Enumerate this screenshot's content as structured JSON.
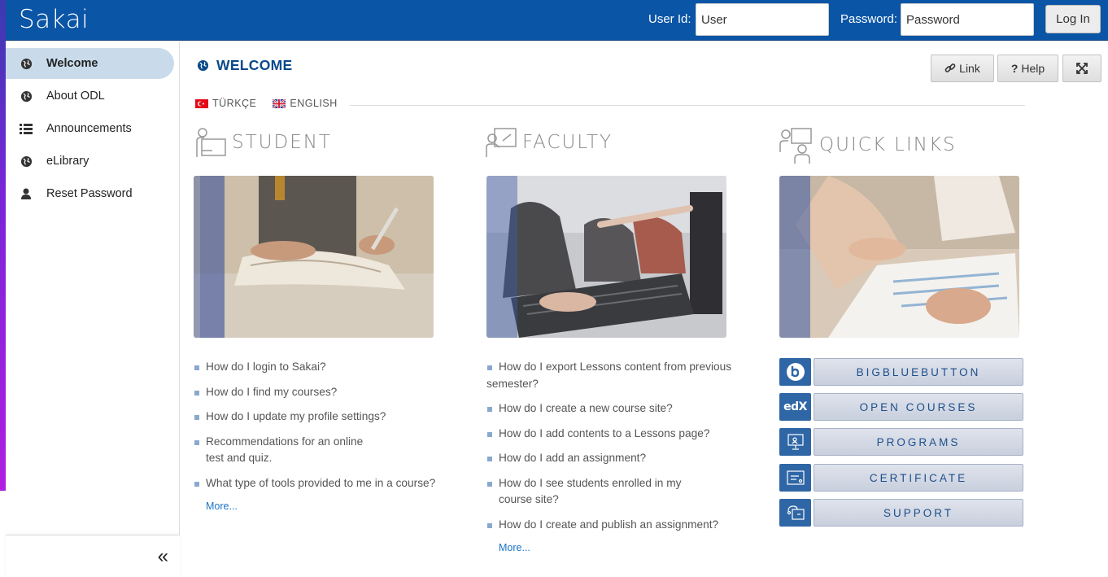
{
  "app": {
    "logo": "Sakai"
  },
  "login": {
    "user_label": "User Id:",
    "user_value": "User",
    "password_label": "Password:",
    "password_value": "Password",
    "login_button": "Log In"
  },
  "sidebar": {
    "items": [
      {
        "label": "Welcome",
        "icon": "globe-icon",
        "active": true
      },
      {
        "label": "About ODL",
        "icon": "globe-icon"
      },
      {
        "label": "Announcements",
        "icon": "list-icon"
      },
      {
        "label": "eLibrary",
        "icon": "globe-icon"
      },
      {
        "label": "Reset Password",
        "icon": "user-icon"
      }
    ],
    "collapse_glyph": "«"
  },
  "page": {
    "title": "WELCOME",
    "toolbar": {
      "link": "Link",
      "help": "Help",
      "fullscreen_icon": "expand-icon"
    }
  },
  "languages": [
    {
      "label": "TÜRKÇE",
      "flag": "turkey-flag"
    },
    {
      "label": "ENGLISH",
      "flag": "uk-flag"
    }
  ],
  "student": {
    "heading": "STUDENT",
    "faq": [
      "How do I login to Sakai?",
      "How do I find my courses?",
      "How do I update my profile settings?",
      "Recommendations for an online test and quiz.",
      "What type of tools provided to me in a course?"
    ],
    "more": "More..."
  },
  "faculty": {
    "heading": "FACULTY",
    "faq": [
      "How do I export Lessons content from previous semester?",
      "How do I create a new course site?",
      "How do I add contents to a Lessons page?",
      "How do I add an assignment?",
      "How do I see students enrolled in my course site?",
      "How do I create and publish an assignment?"
    ],
    "more": "More..."
  },
  "quick_links": {
    "heading": "QUICK LINKS",
    "items": [
      {
        "label": "BIGBLUEBUTTON",
        "icon": "bigbluebutton-icon"
      },
      {
        "label": "OPEN COURSES",
        "icon": "edx-icon",
        "icon_text": "edX"
      },
      {
        "label": "PROGRAMS",
        "icon": "presentation-icon"
      },
      {
        "label": "CERTIFICATE",
        "icon": "certificate-icon"
      },
      {
        "label": "SUPPORT",
        "icon": "support-icon"
      }
    ]
  },
  "colors": {
    "header": "#0a55a6",
    "title": "#0a4a8a",
    "link": "#1a73c8",
    "quick_link_icon": "#2f66a5"
  }
}
